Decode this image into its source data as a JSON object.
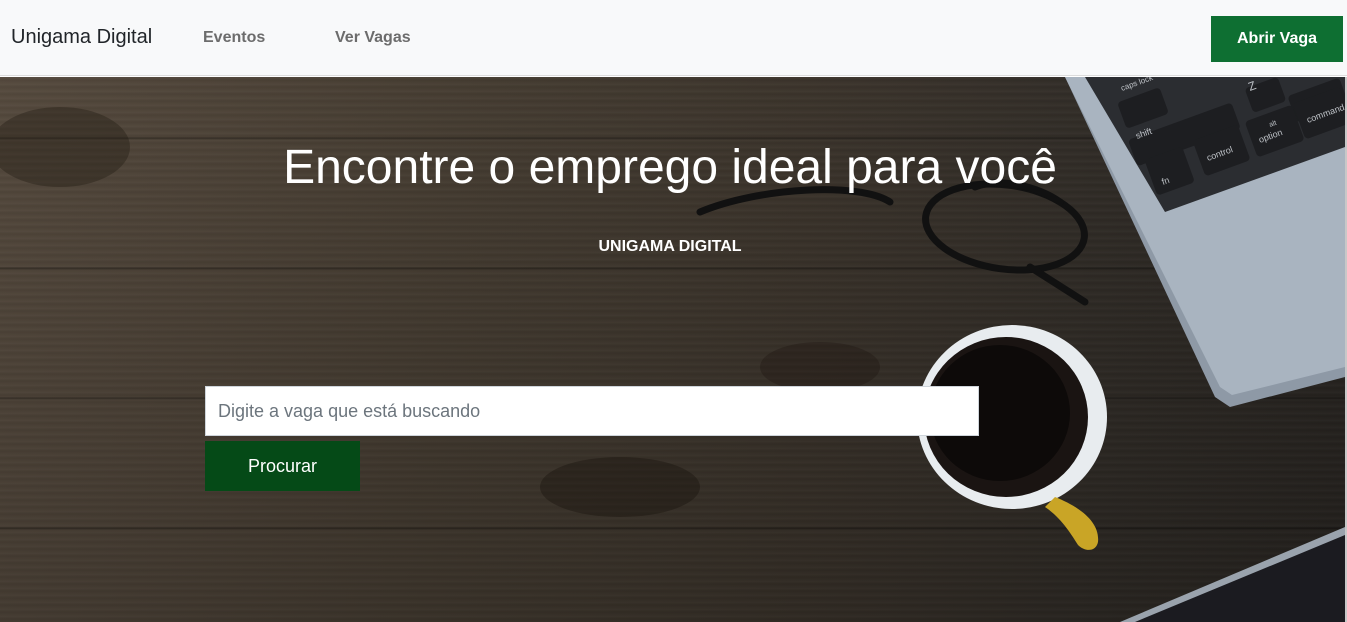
{
  "navbar": {
    "brand": "Unigama Digital",
    "links": [
      {
        "label": "Eventos"
      },
      {
        "label": "Ver Vagas"
      }
    ],
    "cta_label": "Abrir Vaga"
  },
  "hero": {
    "title": "Encontre o emprego ideal para você",
    "subtitle": "UNIGAMA DIGITAL",
    "search": {
      "placeholder": "Digite a vaga que está buscando",
      "value": ""
    },
    "search_button_label": "Procurar"
  },
  "background_image": {
    "keyboard_keys": [
      "shift",
      "fn",
      "control",
      "alt",
      "option",
      "Z",
      "command",
      "caps lock"
    ]
  },
  "colors": {
    "navbar_bg": "#f8f9fa",
    "cta_bg": "#0e6f32",
    "search_button_bg": "#054a17",
    "hero_text": "#ffffff"
  }
}
